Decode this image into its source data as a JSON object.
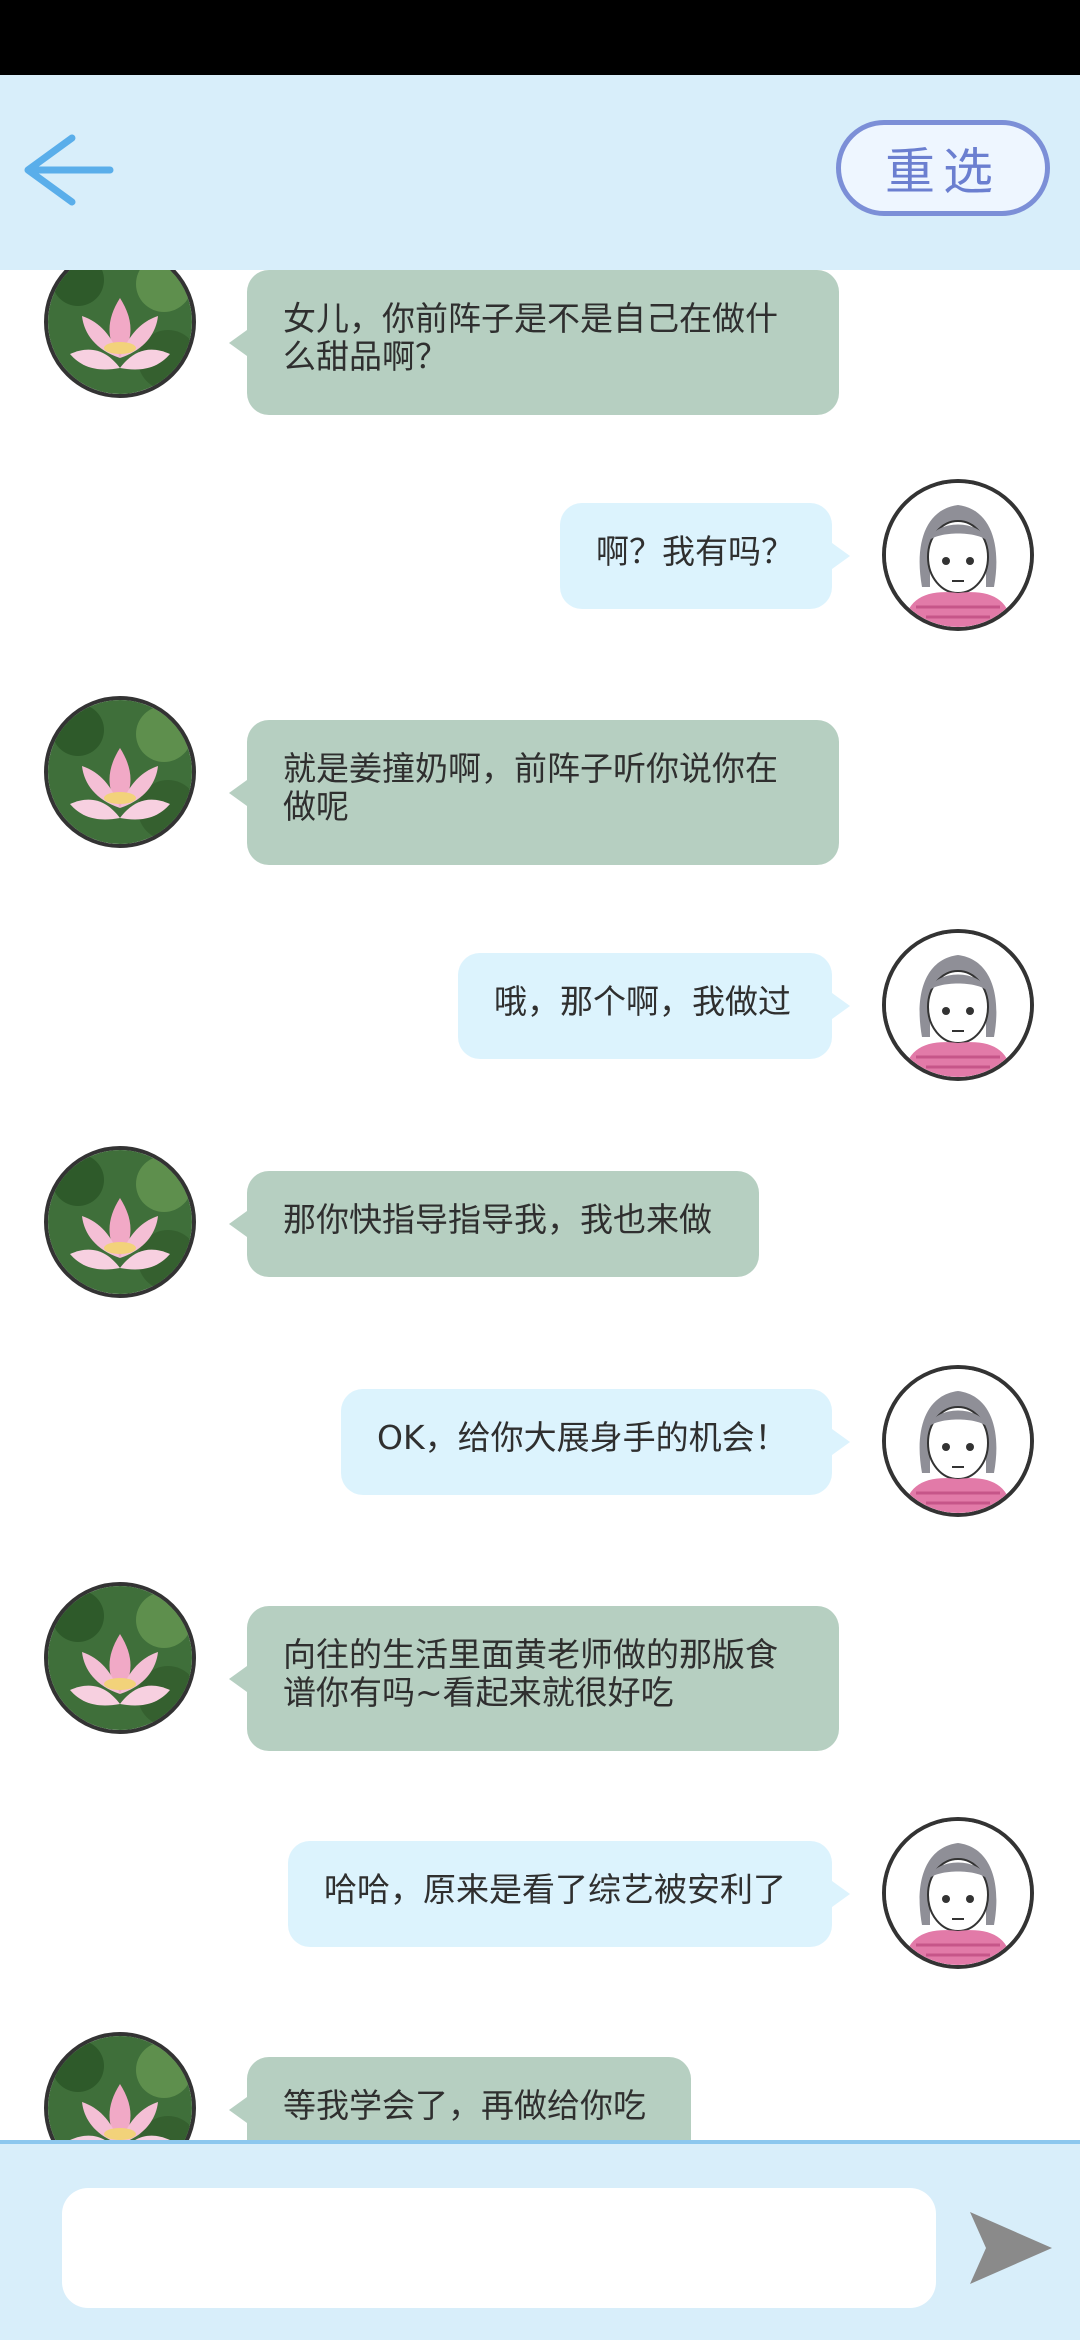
{
  "header": {
    "reselect_label": "重选",
    "back_icon": "arrow-left-icon"
  },
  "messages": [
    {
      "side": "left",
      "avatar": "lotus-avatar",
      "text": "女儿，你前阵子是不是自己在做什\n么甜品啊？"
    },
    {
      "side": "right",
      "avatar": "girl-avatar",
      "text": "啊？我有吗？"
    },
    {
      "side": "left",
      "avatar": "lotus-avatar",
      "text": "就是姜撞奶啊，前阵子听你说你在\n做呢"
    },
    {
      "side": "right",
      "avatar": "girl-avatar",
      "text": "哦，那个啊，我做过"
    },
    {
      "side": "left",
      "avatar": "lotus-avatar",
      "text": "那你快指导指导我，我也来做"
    },
    {
      "side": "right",
      "avatar": "girl-avatar",
      "text": "OK，给你大展身手的机会！"
    },
    {
      "side": "left",
      "avatar": "lotus-avatar",
      "text": "向往的生活里面黄老师做的那版食\n谱你有吗~看起来就很好吃"
    },
    {
      "side": "right",
      "avatar": "girl-avatar",
      "text": "哈哈，原来是看了综艺被安利了"
    },
    {
      "side": "left",
      "avatar": "lotus-avatar",
      "text": "等我学会了，再做给你吃"
    }
  ],
  "composer": {
    "input_value": "",
    "send_icon": "send-arrow-icon"
  },
  "colors": {
    "header_bg": "#d8eefa",
    "left_bubble": "#b6cfc1",
    "right_bubble": "#dcf3fd",
    "accent": "#6b7fd0"
  }
}
